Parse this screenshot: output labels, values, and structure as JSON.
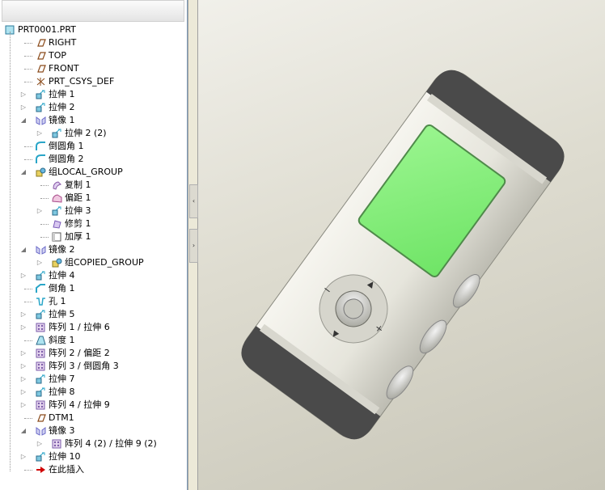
{
  "model_tree": {
    "items": [
      {
        "label": "PRT0001.PRT",
        "icon": "part-icon",
        "indent": 0,
        "expander": ""
      },
      {
        "label": "RIGHT",
        "icon": "datum-plane-icon",
        "indent": 1,
        "expander": ""
      },
      {
        "label": "TOP",
        "icon": "datum-plane-icon",
        "indent": 1,
        "expander": ""
      },
      {
        "label": "FRONT",
        "icon": "datum-plane-icon",
        "indent": 1,
        "expander": ""
      },
      {
        "label": "PRT_CSYS_DEF",
        "icon": "csys-icon",
        "indent": 1,
        "expander": ""
      },
      {
        "label": "拉伸 1",
        "icon": "extrude-icon",
        "indent": 1,
        "expander": "▷"
      },
      {
        "label": "拉伸 2",
        "icon": "extrude-icon",
        "indent": 1,
        "expander": "▷"
      },
      {
        "label": "镜像 1",
        "icon": "mirror-icon",
        "indent": 1,
        "expander": "◢"
      },
      {
        "label": "拉伸 2 (2)",
        "icon": "extrude-icon",
        "indent": 2,
        "expander": "▷"
      },
      {
        "label": "倒圆角 1",
        "icon": "round-icon",
        "indent": 1,
        "expander": ""
      },
      {
        "label": "倒圆角 2",
        "icon": "round-icon",
        "indent": 1,
        "expander": ""
      },
      {
        "label": "组LOCAL_GROUP",
        "icon": "group-icon",
        "indent": 1,
        "expander": "◢"
      },
      {
        "label": "复制 1",
        "icon": "copy-icon",
        "indent": 2,
        "expander": ""
      },
      {
        "label": "偏距 1",
        "icon": "offset-icon",
        "indent": 2,
        "expander": ""
      },
      {
        "label": "拉伸 3",
        "icon": "extrude-icon",
        "indent": 2,
        "expander": "▷"
      },
      {
        "label": "修剪 1",
        "icon": "trim-icon",
        "indent": 2,
        "expander": ""
      },
      {
        "label": "加厚 1",
        "icon": "thicken-icon",
        "indent": 2,
        "expander": ""
      },
      {
        "label": "镜像 2",
        "icon": "mirror-icon",
        "indent": 1,
        "expander": "◢"
      },
      {
        "label": "组COPIED_GROUP",
        "icon": "group-icon",
        "indent": 2,
        "expander": "▷"
      },
      {
        "label": "拉伸 4",
        "icon": "extrude-icon",
        "indent": 1,
        "expander": "▷"
      },
      {
        "label": "倒角 1",
        "icon": "chamfer-icon",
        "indent": 1,
        "expander": ""
      },
      {
        "label": "孔 1",
        "icon": "hole-icon",
        "indent": 1,
        "expander": ""
      },
      {
        "label": "拉伸 5",
        "icon": "extrude-icon",
        "indent": 1,
        "expander": "▷"
      },
      {
        "label": "阵列 1 / 拉伸 6",
        "icon": "pattern-icon",
        "indent": 1,
        "expander": "▷"
      },
      {
        "label": "斜度 1",
        "icon": "draft-icon",
        "indent": 1,
        "expander": ""
      },
      {
        "label": "阵列 2 / 偏距 2",
        "icon": "pattern-icon",
        "indent": 1,
        "expander": "▷"
      },
      {
        "label": "阵列 3 / 倒圆角 3",
        "icon": "pattern-icon",
        "indent": 1,
        "expander": "▷"
      },
      {
        "label": "拉伸 7",
        "icon": "extrude-icon",
        "indent": 1,
        "expander": "▷"
      },
      {
        "label": "拉伸 8",
        "icon": "extrude-icon",
        "indent": 1,
        "expander": "▷"
      },
      {
        "label": "阵列 4 / 拉伸 9",
        "icon": "pattern-icon",
        "indent": 1,
        "expander": "▷"
      },
      {
        "label": "DTM1",
        "icon": "datum-plane-icon",
        "indent": 1,
        "expander": ""
      },
      {
        "label": "镜像 3",
        "icon": "mirror-icon",
        "indent": 1,
        "expander": "◢"
      },
      {
        "label": "阵列 4 (2) / 拉伸 9 (2)",
        "icon": "pattern-icon",
        "indent": 2,
        "expander": "▷"
      },
      {
        "label": "拉伸 10",
        "icon": "extrude-icon",
        "indent": 1,
        "expander": "▷"
      },
      {
        "label": "在此插入",
        "icon": "insert-here-arrow-icon",
        "indent": 1,
        "expander": ""
      }
    ]
  },
  "splitter": {
    "collapse_glyph": "‹",
    "expand_glyph": "›"
  },
  "model": {
    "screen_color": "#86f07c",
    "body_color": "#e6e5dc",
    "cap_color": "#4a4a4a"
  },
  "colors": {
    "extrude": "#2aa6c8",
    "datum": "#8a4a1a",
    "mirror": "#6a6ac8",
    "pattern": "#9a6ab8",
    "insert_arrow": "#d00000"
  }
}
